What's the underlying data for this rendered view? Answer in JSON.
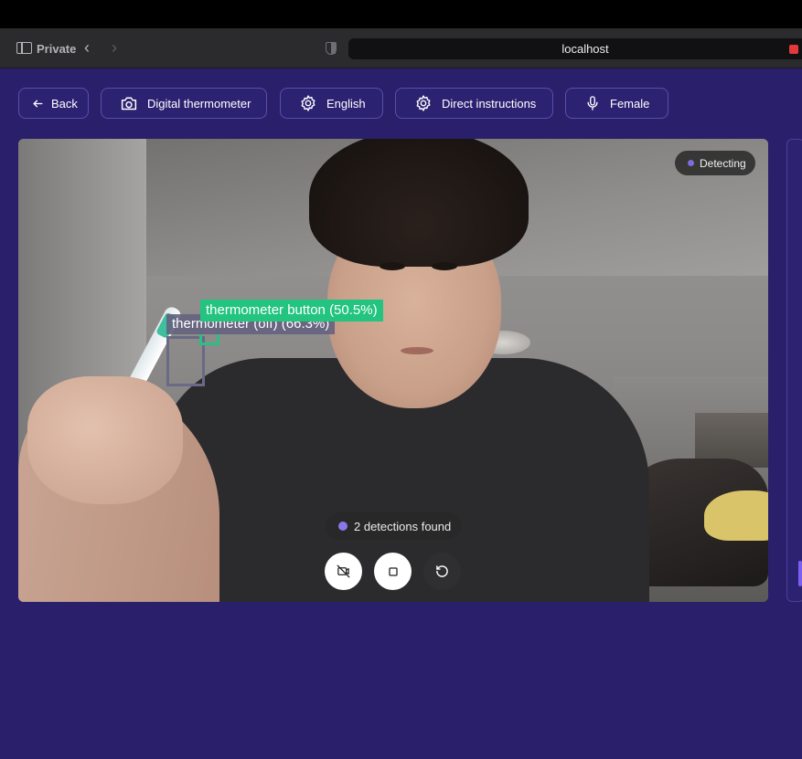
{
  "browser": {
    "private_label": "Private",
    "url": "localhost"
  },
  "toolbar": {
    "back_label": "Back",
    "device_label": "Digital thermometer",
    "language_label": "English",
    "mode_label": "Direct instructions",
    "voice_label": "Female"
  },
  "camera": {
    "status": "Detecting",
    "detections_summary": "2 detections found",
    "detections": [
      {
        "label": "thermometer (off) (66.3%)",
        "color": "#6a6986"
      },
      {
        "label": "thermometer button (50.5%)",
        "color": "#22c47f"
      }
    ]
  },
  "controls": {
    "camera_off_icon": "video-off-icon",
    "stop_icon": "stop-icon",
    "reset_icon": "rotate-ccw-icon"
  },
  "theme": {
    "background": "#2a1f6b",
    "button_bg": "#2c2272",
    "button_border": "#5a4fa8",
    "accent": "#8b77ea"
  }
}
